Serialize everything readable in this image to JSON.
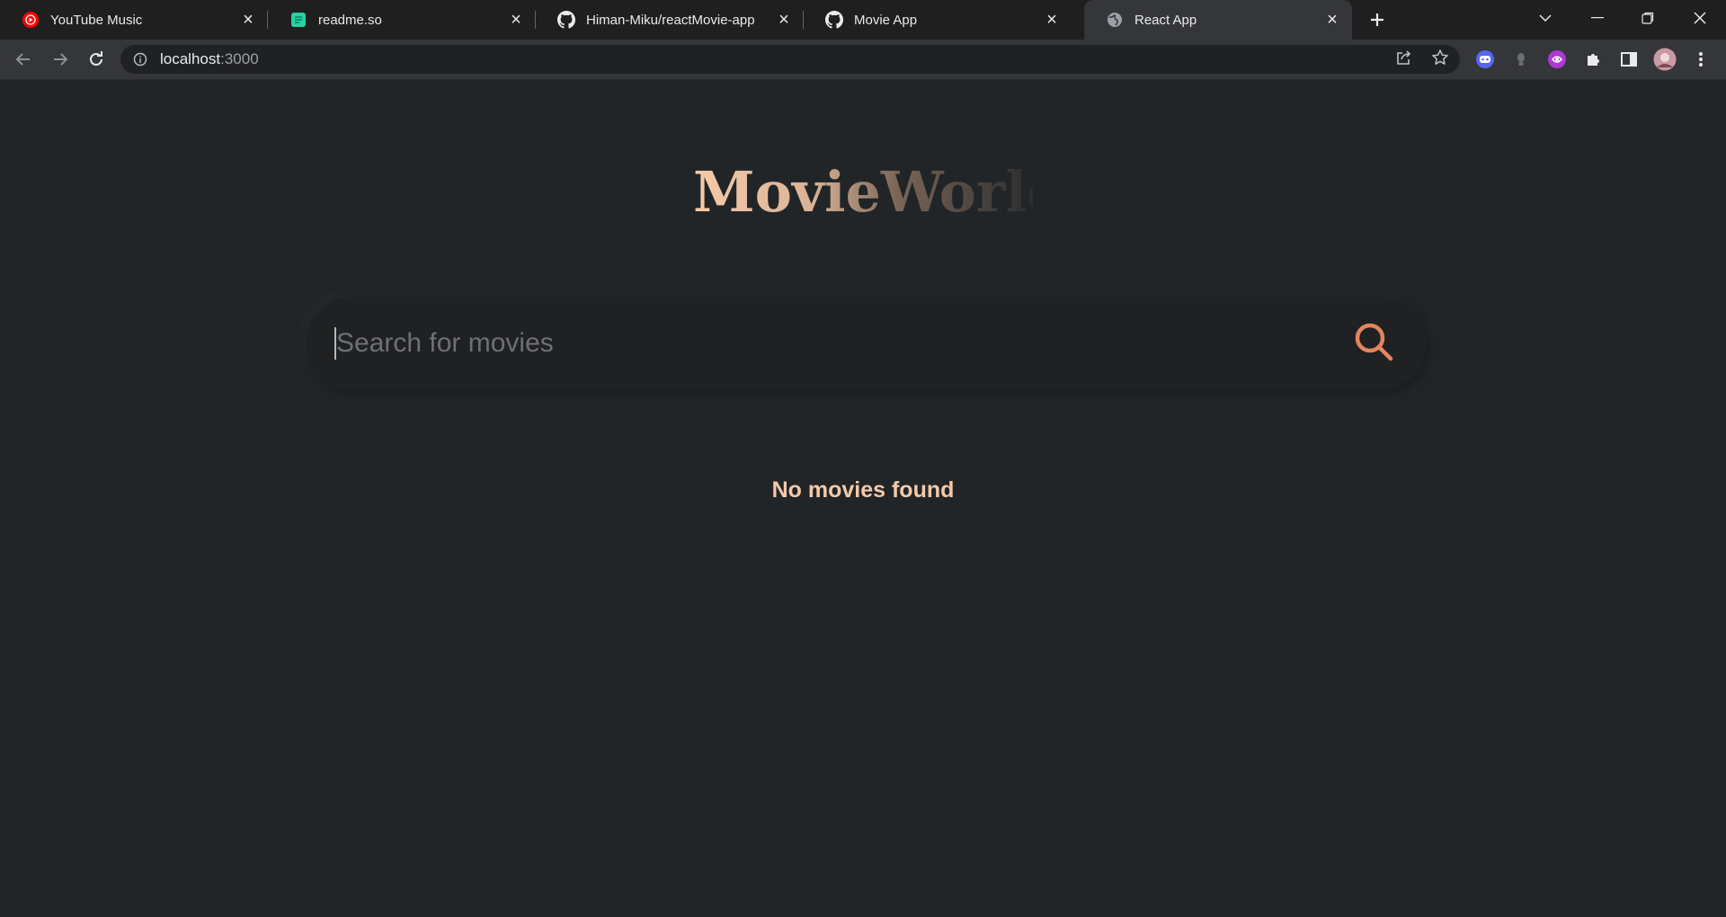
{
  "browser": {
    "tabs": [
      {
        "title": "YouTube Music",
        "icon": "youtube-music-icon",
        "active": false
      },
      {
        "title": "readme.so",
        "icon": "readme-so-icon",
        "active": false
      },
      {
        "title": "Himan-Miku/reactMovie-app",
        "icon": "github-icon",
        "active": false
      },
      {
        "title": "Movie App",
        "icon": "github-icon",
        "active": false
      },
      {
        "title": "React App",
        "icon": "globe-icon",
        "active": true
      }
    ],
    "url_host": "localhost",
    "url_port": ":3000"
  },
  "app": {
    "logo": "MovieWorld",
    "search_placeholder": "Search for movies",
    "search_value": "",
    "empty_message": "No movies found",
    "accent_color": "#e4855c",
    "text_accent_color": "#f6c9a8"
  }
}
